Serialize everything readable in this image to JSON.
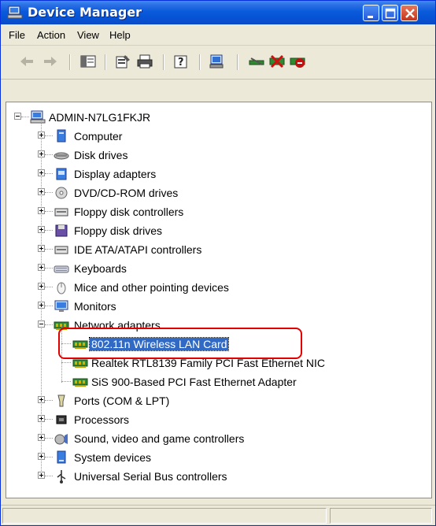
{
  "window": {
    "title": "Device Manager",
    "controls": [
      "minimize",
      "maximize",
      "close"
    ]
  },
  "menu": [
    "File",
    "Action",
    "View",
    "Help"
  ],
  "toolbar": {
    "buttons": [
      "back-icon",
      "forward-icon",
      "show-hide-console-tree-icon",
      "properties-icon",
      "print-icon",
      "help-icon",
      "scan-hardware-icon",
      "update-driver-icon",
      "uninstall-icon",
      "disable-icon"
    ]
  },
  "tree": {
    "root": "ADMIN-N7LG1FKJR",
    "categories": [
      {
        "label": "Computer",
        "icon": "computer-icon",
        "expanded": false
      },
      {
        "label": "Disk drives",
        "icon": "disk-drive-icon",
        "expanded": false
      },
      {
        "label": "Display adapters",
        "icon": "display-adapter-icon",
        "expanded": false
      },
      {
        "label": "DVD/CD-ROM drives",
        "icon": "dvd-icon",
        "expanded": false
      },
      {
        "label": "Floppy disk controllers",
        "icon": "controller-icon",
        "expanded": false
      },
      {
        "label": "Floppy disk drives",
        "icon": "floppy-icon",
        "expanded": false
      },
      {
        "label": "IDE ATA/ATAPI controllers",
        "icon": "controller-icon",
        "expanded": false
      },
      {
        "label": "Keyboards",
        "icon": "keyboard-icon",
        "expanded": false
      },
      {
        "label": "Mice and other pointing devices",
        "icon": "mouse-icon",
        "expanded": false
      },
      {
        "label": "Monitors",
        "icon": "monitor-icon",
        "expanded": false
      },
      {
        "label": "Network adapters",
        "icon": "network-card-icon",
        "expanded": true,
        "children": [
          {
            "label": "802.11n Wireless LAN Card",
            "icon": "network-card-icon",
            "selected": true
          },
          {
            "label": "Realtek RTL8139 Family PCI Fast Ethernet NIC",
            "icon": "network-card-icon"
          },
          {
            "label": "SiS 900-Based PCI Fast Ethernet Adapter",
            "icon": "network-card-icon"
          }
        ]
      },
      {
        "label": "Ports (COM & LPT)",
        "icon": "port-icon",
        "expanded": false
      },
      {
        "label": "Processors",
        "icon": "processor-icon",
        "expanded": false
      },
      {
        "label": "Sound, video and game controllers",
        "icon": "sound-icon",
        "expanded": false
      },
      {
        "label": "System devices",
        "icon": "system-icon",
        "expanded": false
      },
      {
        "label": "Universal Serial Bus controllers",
        "icon": "usb-icon",
        "expanded": false
      }
    ]
  },
  "colors": {
    "titlebar": "#0a5bdc",
    "selection": "#316ac5",
    "highlight_ring": "#e30000"
  }
}
